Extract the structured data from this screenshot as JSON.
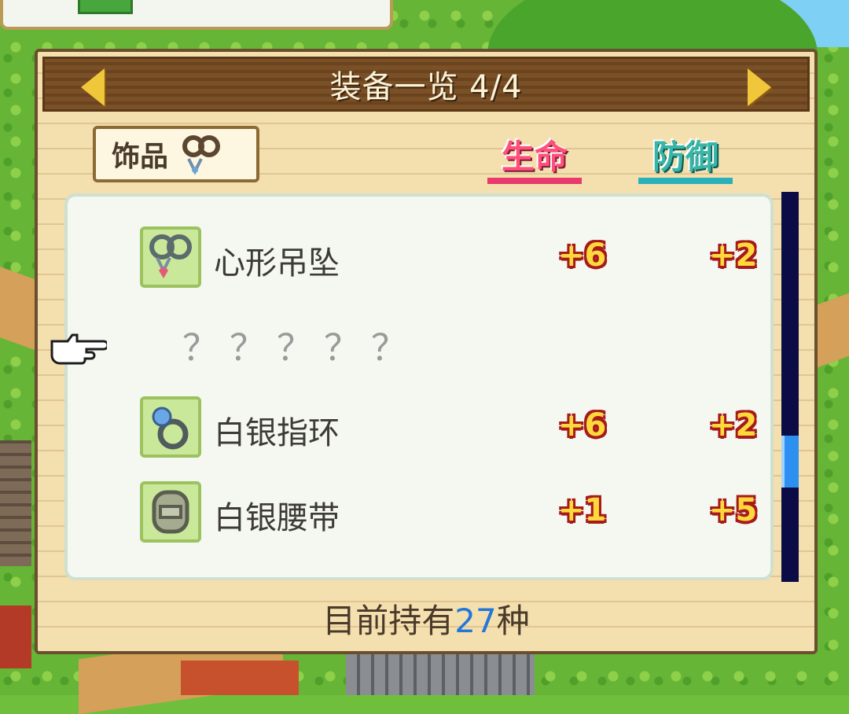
{
  "header": {
    "title": "装备一览 4/4"
  },
  "category": {
    "label": "饰品",
    "icon": "necklace-ring-icon"
  },
  "columns": {
    "life": "生命",
    "defense": "防御"
  },
  "items": [
    {
      "name": "心形吊坠",
      "life": "+6",
      "defense": "+2",
      "icon": "heart-pendant-icon"
    },
    {
      "name": "？？？？？",
      "life": "",
      "defense": "",
      "icon": ""
    },
    {
      "name": "白银指环",
      "life": "+6",
      "defense": "+2",
      "icon": "silver-ring-icon"
    },
    {
      "name": "白银腰带",
      "life": "+1",
      "defense": "+5",
      "icon": "silver-belt-icon"
    }
  ],
  "footer": {
    "prefix": "目前持有",
    "count": "27",
    "suffix": "种"
  },
  "colors": {
    "life": "#ff4f7a",
    "defense": "#39b5a8",
    "count": "#2377d8",
    "stat": "#ffd93c"
  }
}
